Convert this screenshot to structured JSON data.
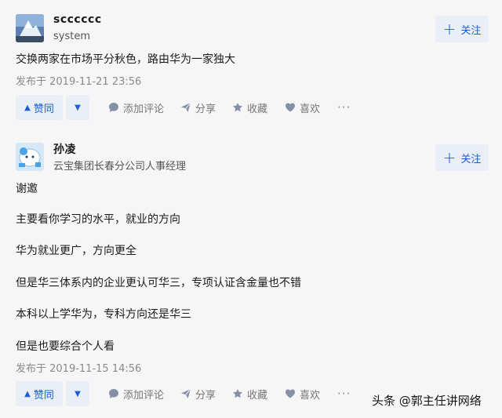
{
  "answers": [
    {
      "author": {
        "name": "scccccc",
        "description": "system"
      },
      "follow_label": "关注",
      "content": [
        "交换两家在市场平分秋色，路由华为一家独大"
      ],
      "time": "发布于 2019-11-21 23:56",
      "actions": {
        "upvote": "赞同",
        "comment": "添加评论",
        "share": "分享",
        "favorite": "收藏",
        "like": "喜欢",
        "more": "···"
      }
    },
    {
      "author": {
        "name": "孙凌",
        "description": "云宝集团长春分公司人事经理"
      },
      "follow_label": "关注",
      "content": [
        "谢邀",
        "主要看你学习的水平，就业的方向",
        "华为就业更广，方向更全",
        "但是华三体系内的企业更认可华三，专项认证含金量也不错",
        "本科以上学华为，专科方向还是华三",
        "但是也要综合个人看"
      ],
      "time": "发布于 2019-11-15 14:56",
      "actions": {
        "upvote": "赞同",
        "comment": "添加评论",
        "share": "分享",
        "favorite": "收藏",
        "like": "喜欢",
        "more": "···"
      }
    }
  ],
  "watermark": "头条 @郭主任讲网络",
  "colors": {
    "accent": "#1a5fd0",
    "button_bg": "#e9eef7",
    "muted": "#8a8a8a",
    "icon": "#8590a6"
  }
}
